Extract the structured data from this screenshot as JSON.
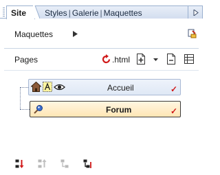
{
  "tabs": {
    "active": "Site",
    "others": [
      "Styles",
      "Galerie",
      "Maquettes"
    ],
    "separator": "|"
  },
  "maquettes_row": {
    "label": "Maquettes"
  },
  "pages_row": {
    "label": "Pages",
    "html_label": ".html"
  },
  "pages": [
    {
      "title": "Accueil",
      "is_home": true
    },
    {
      "title": "Forum",
      "is_home": false
    }
  ],
  "colors": {
    "accent_red": "#d01818",
    "tab_border": "#9ab0cf",
    "home_node_bg": "#dfe8f5",
    "forum_node_bg": "#ffe6b4"
  },
  "icons": {
    "maquettes_play": "play-arrow-icon",
    "maquettes_action": "stamp-icon",
    "refresh": "refresh-icon",
    "new_page": "add-page-icon",
    "new_page_menu": "dropdown-arrow-icon",
    "page": "page-icon",
    "page_list": "page-list-icon",
    "home": "home-icon",
    "text_mode": "text-box-icon",
    "visibility": "eye-icon",
    "forum": "forum-pin-icon",
    "checkmark": "checkmark-icon",
    "bottom": [
      "sort-red-icon",
      "sort-disabled-icon",
      "move-disabled-icon",
      "sort-active-icon"
    ]
  }
}
